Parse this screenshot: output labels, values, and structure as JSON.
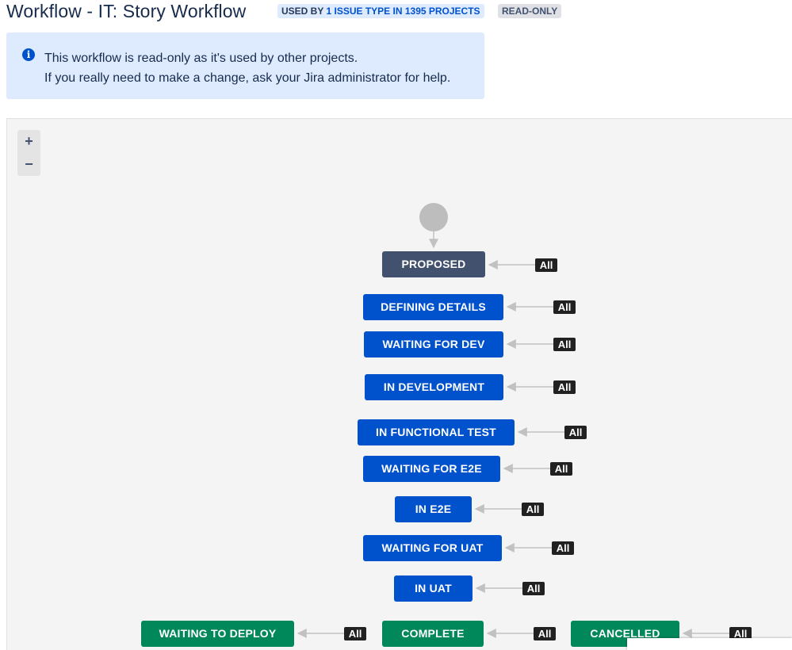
{
  "header": {
    "title": "Workflow - IT: Story Workflow",
    "used_by_prefix": "USED BY",
    "used_by_link": "1 ISSUE TYPE IN 1395 PROJECTS",
    "readonly_label": "READ-ONLY"
  },
  "info_message": {
    "icon": "info-icon",
    "line1": "This workflow is read-only as it's used by other projects.",
    "line2": "If you really need to make a change, ask your Jira administrator for help."
  },
  "zoom": {
    "in_label": "+",
    "out_label": "−"
  },
  "transition_label": "All",
  "statuses": [
    {
      "name": "PROPOSED",
      "category": "to-do"
    },
    {
      "name": "DEFINING DETAILS",
      "category": "in-progress"
    },
    {
      "name": "WAITING FOR DEV",
      "category": "in-progress"
    },
    {
      "name": "IN DEVELOPMENT",
      "category": "in-progress"
    },
    {
      "name": "IN FUNCTIONAL TEST",
      "category": "in-progress"
    },
    {
      "name": "WAITING FOR E2E",
      "category": "in-progress"
    },
    {
      "name": "IN E2E",
      "category": "in-progress"
    },
    {
      "name": "WAITING FOR UAT",
      "category": "in-progress"
    },
    {
      "name": "IN UAT",
      "category": "in-progress"
    },
    {
      "name": "WAITING TO DEPLOY",
      "category": "done"
    },
    {
      "name": "COMPLETE",
      "category": "done"
    },
    {
      "name": "CANCELLED",
      "category": "done"
    }
  ],
  "colors": {
    "to_do": "#42526E",
    "in_progress": "#0052CC",
    "done": "#00875A",
    "info_background": "#DEEBFF",
    "canvas_background": "#F4F4F4"
  }
}
